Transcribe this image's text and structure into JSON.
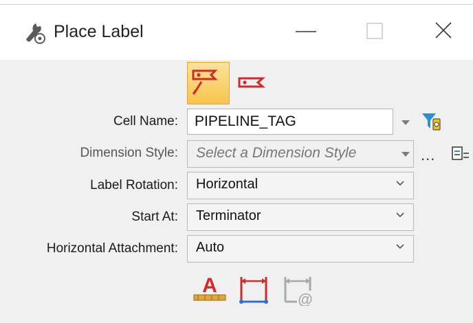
{
  "window": {
    "title": "Place Label",
    "icon": "tool-settings-icon",
    "controls": {
      "minimize": "minimize-icon",
      "maximize": "maximize-icon",
      "close": "close-icon"
    }
  },
  "tools": [
    {
      "name": "place-label-leader-tool",
      "icon": "label-with-leader-icon",
      "active": true
    },
    {
      "name": "place-label-tool",
      "icon": "label-icon",
      "active": false
    }
  ],
  "form": {
    "cell_name": {
      "label": "Cell Name:",
      "value": "PIPELINE_TAG"
    },
    "dimension_style": {
      "label": "Dimension Style:",
      "placeholder": "Select a Dimension Style",
      "more": "..."
    },
    "label_rotation": {
      "label": "Label Rotation:",
      "value": "Horizontal"
    },
    "start_at": {
      "label": "Start At:",
      "value": "Terminator"
    },
    "horizontal_attachment": {
      "label": "Horizontal Attachment:",
      "value": "Auto"
    }
  },
  "bottom_tools": [
    {
      "icon": "text-style-icon"
    },
    {
      "icon": "dimension-style-icon"
    },
    {
      "icon": "dimension-at-icon",
      "disabled": true
    }
  ],
  "colors": {
    "accent_red": "#d12a2a",
    "active_tool_bg": "#f9c955",
    "filter_icon_blue": "#2b8fd6",
    "filter_icon_yellow": "#f2c31b"
  }
}
